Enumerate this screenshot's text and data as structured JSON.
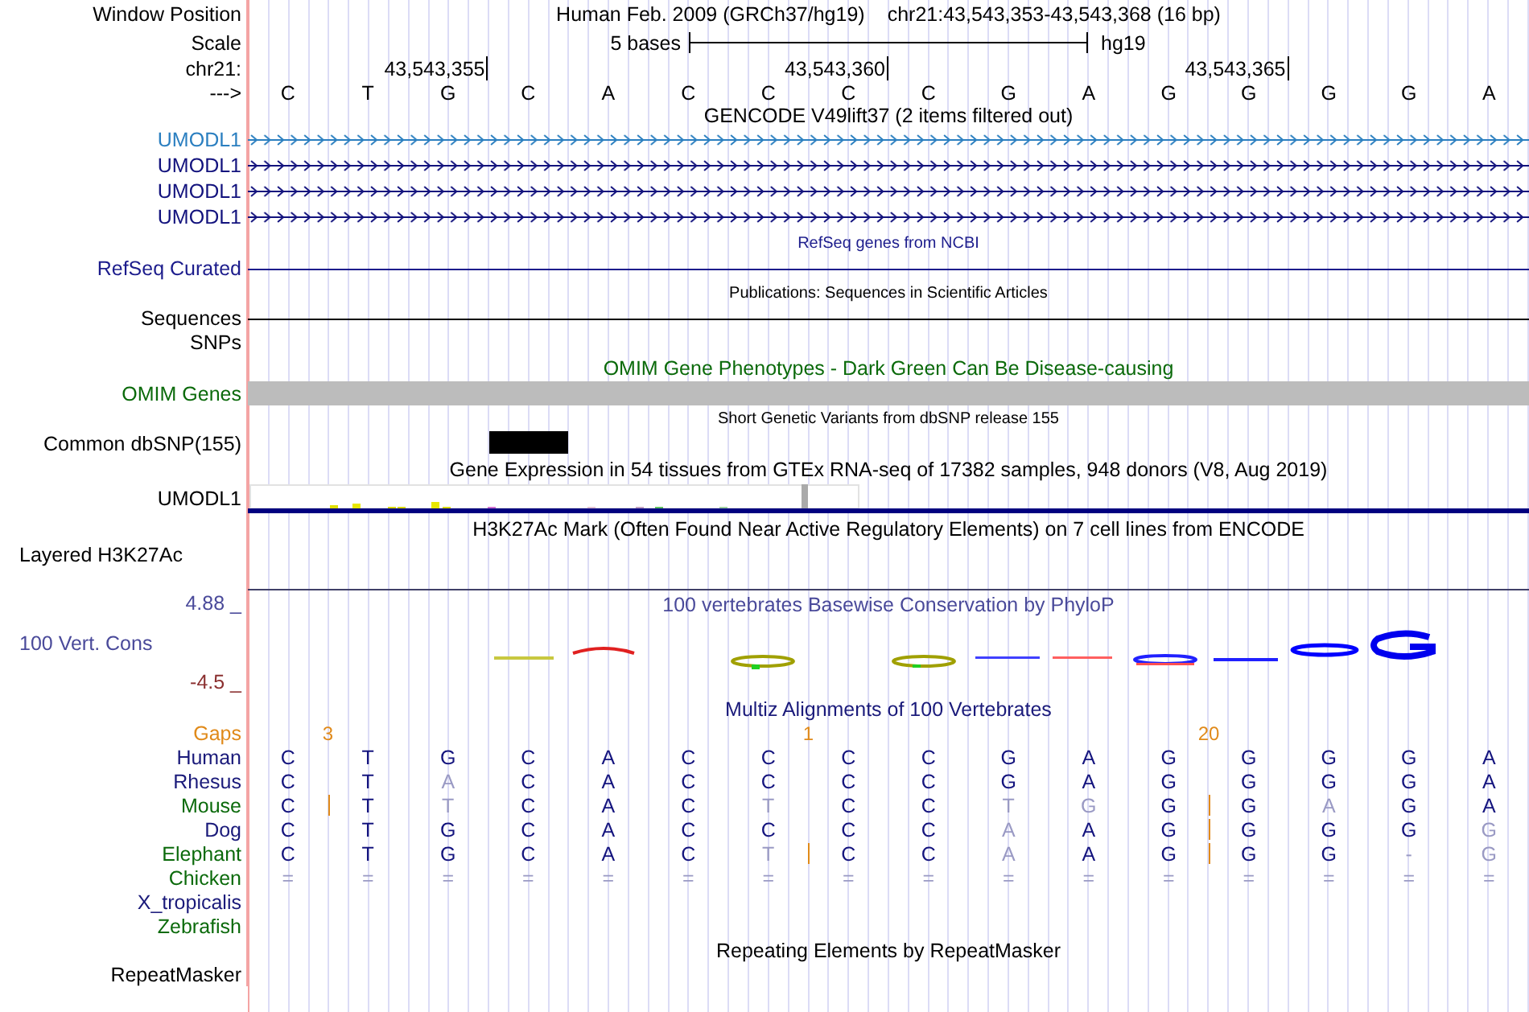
{
  "header": {
    "position_label": "Window Position",
    "assembly": "Human Feb. 2009 (GRCh37/hg19)",
    "position": "chr21:43,543,353-43,543,368 (16 bp)",
    "scale_label": "Scale",
    "scale_text": "5 bases",
    "scale_assembly": "hg19",
    "chrom_label": "chr21:",
    "strand_label": "--->",
    "bases": [
      {
        "base": "C"
      },
      {
        "base": "T"
      },
      {
        "base": "G",
        "tick": "43,543,355"
      },
      {
        "base": "C"
      },
      {
        "base": "A"
      },
      {
        "base": "C"
      },
      {
        "base": "C"
      },
      {
        "base": "C",
        "tick": "43,543,360"
      },
      {
        "base": "C"
      },
      {
        "base": "G"
      },
      {
        "base": "A"
      },
      {
        "base": "G"
      },
      {
        "base": "G",
        "tick": "43,543,365"
      },
      {
        "base": "G"
      },
      {
        "base": "G"
      },
      {
        "base": "A"
      }
    ]
  },
  "tracks": [
    {
      "kind": "gene",
      "title": "GENCODE V49lift37 (2 items filtered out)",
      "color": "#000000",
      "items": [
        {
          "label": "UMODL1",
          "color": "#2b7fc0"
        },
        {
          "label": "UMODL1",
          "color": "#12127d"
        },
        {
          "label": "UMODL1",
          "color": "#12127d"
        },
        {
          "label": "UMODL1",
          "color": "#12127d"
        }
      ]
    },
    {
      "kind": "line",
      "title": "RefSeq genes from NCBI",
      "color": "#1c1c8c",
      "labels": [
        "RefSeq Curated"
      ]
    },
    {
      "kind": "line",
      "title": "Publications: Sequences in Scientific Articles",
      "color": "#000000",
      "labels": [
        "Sequences",
        "SNPs"
      ]
    },
    {
      "kind": "bar",
      "title": "OMIM Gene Phenotypes - Dark Green Can Be Disease-causing",
      "color": "#0b6a0b",
      "labels": [
        "OMIM Genes"
      ]
    },
    {
      "kind": "snp",
      "title": "Short Genetic Variants from dbSNP release 155",
      "color": "#000000",
      "labels": [
        "Common dbSNP(155)"
      ],
      "columns": [
        {
          "variant": false
        },
        {
          "variant": false
        },
        {
          "variant": false
        },
        {
          "variant": true
        },
        {
          "variant": false
        },
        {
          "variant": false
        },
        {
          "variant": false
        },
        {
          "variant": false
        },
        {
          "variant": false
        },
        {
          "variant": false
        },
        {
          "variant": false
        },
        {
          "variant": false
        },
        {
          "variant": false
        },
        {
          "variant": false
        },
        {
          "variant": false
        },
        {
          "variant": false
        }
      ]
    },
    {
      "kind": "expression",
      "title": "Gene Expression in 54 tissues from GTEx RNA-seq of 17382 samples, 948 donors (V8, Aug 2019)",
      "color": "#000000",
      "labels": [
        "UMODL1"
      ]
    },
    {
      "kind": "layered",
      "title": "H3K27Ac Mark (Often Found Near Active Regulatory Elements) on 7 cell lines from ENCODE",
      "color": "#000000",
      "labels": [
        "Layered H3K27Ac"
      ]
    },
    {
      "kind": "conservation",
      "title": "100 vertebrates Basewise Conservation by PhyloP",
      "color": "#4a4a9a",
      "labels": [
        "100 Vert. Cons"
      ],
      "max_label": "4.88 _",
      "min_label": "-4.5 _"
    },
    {
      "kind": "alignment",
      "title": "Multiz Alignments of 100 Vertebrates",
      "color": "#1a1a7a",
      "gap_label": "Gaps",
      "species": [
        {
          "name": "Human",
          "color": "#1a1a7a",
          "bases": [
            {
              "b": "C",
              "faded": false,
              "insert_after": false,
              "gap": "3"
            },
            {
              "b": "T",
              "faded": false,
              "insert_after": false
            },
            {
              "b": "G",
              "faded": false,
              "insert_after": false
            },
            {
              "b": "C",
              "faded": false,
              "insert_after": false
            },
            {
              "b": "A",
              "faded": false,
              "insert_after": false
            },
            {
              "b": "C",
              "faded": false,
              "insert_after": false
            },
            {
              "b": "C",
              "faded": false,
              "insert_after": false,
              "gap": "1"
            },
            {
              "b": "C",
              "faded": false,
              "insert_after": false
            },
            {
              "b": "C",
              "faded": false,
              "insert_after": false
            },
            {
              "b": "G",
              "faded": false,
              "insert_after": false
            },
            {
              "b": "A",
              "faded": false,
              "insert_after": false
            },
            {
              "b": "G",
              "faded": false,
              "insert_after": false,
              "gap": "20"
            },
            {
              "b": "G",
              "faded": false,
              "insert_after": false
            },
            {
              "b": "G",
              "faded": false,
              "insert_after": false
            },
            {
              "b": "G",
              "faded": false,
              "insert_after": false
            },
            {
              "b": "A",
              "faded": false,
              "insert_after": false
            }
          ]
        },
        {
          "name": "Rhesus",
          "color": "#1a1a7a",
          "bases": [
            {
              "b": "C",
              "faded": false,
              "insert_after": false
            },
            {
              "b": "T",
              "faded": false,
              "insert_after": false
            },
            {
              "b": "A",
              "faded": true,
              "insert_after": false
            },
            {
              "b": "C",
              "faded": false,
              "insert_after": false
            },
            {
              "b": "A",
              "faded": false,
              "insert_after": false
            },
            {
              "b": "C",
              "faded": false,
              "insert_after": false
            },
            {
              "b": "C",
              "faded": false,
              "insert_after": false
            },
            {
              "b": "C",
              "faded": false,
              "insert_after": false
            },
            {
              "b": "C",
              "faded": false,
              "insert_after": false
            },
            {
              "b": "G",
              "faded": false,
              "insert_after": false
            },
            {
              "b": "A",
              "faded": false,
              "insert_after": false
            },
            {
              "b": "G",
              "faded": false,
              "insert_after": false
            },
            {
              "b": "G",
              "faded": false,
              "insert_after": false
            },
            {
              "b": "G",
              "faded": false,
              "insert_after": false
            },
            {
              "b": "G",
              "faded": false,
              "insert_after": false
            },
            {
              "b": "A",
              "faded": false,
              "insert_after": false
            }
          ]
        },
        {
          "name": "Mouse",
          "color": "#0b6a0b",
          "bases": [
            {
              "b": "C",
              "faded": false,
              "insert_after": true
            },
            {
              "b": "T",
              "faded": false,
              "insert_after": false
            },
            {
              "b": "T",
              "faded": true,
              "insert_after": false
            },
            {
              "b": "C",
              "faded": false,
              "insert_after": false
            },
            {
              "b": "A",
              "faded": false,
              "insert_after": false
            },
            {
              "b": "C",
              "faded": false,
              "insert_after": false
            },
            {
              "b": "T",
              "faded": true,
              "insert_after": false
            },
            {
              "b": "C",
              "faded": false,
              "insert_after": false
            },
            {
              "b": "C",
              "faded": false,
              "insert_after": false
            },
            {
              "b": "T",
              "faded": true,
              "insert_after": false
            },
            {
              "b": "G",
              "faded": true,
              "insert_after": false
            },
            {
              "b": "G",
              "faded": false,
              "insert_after": true
            },
            {
              "b": "G",
              "faded": false,
              "insert_after": false
            },
            {
              "b": "A",
              "faded": true,
              "insert_after": false
            },
            {
              "b": "G",
              "faded": false,
              "insert_after": false
            },
            {
              "b": "A",
              "faded": false,
              "insert_after": false
            }
          ]
        },
        {
          "name": "Dog",
          "color": "#1a1a7a",
          "bases": [
            {
              "b": "C",
              "faded": false,
              "insert_after": false
            },
            {
              "b": "T",
              "faded": false,
              "insert_after": false
            },
            {
              "b": "G",
              "faded": false,
              "insert_after": false
            },
            {
              "b": "C",
              "faded": false,
              "insert_after": false
            },
            {
              "b": "A",
              "faded": false,
              "insert_after": false
            },
            {
              "b": "C",
              "faded": false,
              "insert_after": false
            },
            {
              "b": "C",
              "faded": false,
              "insert_after": false
            },
            {
              "b": "C",
              "faded": false,
              "insert_after": false
            },
            {
              "b": "C",
              "faded": false,
              "insert_after": false
            },
            {
              "b": "A",
              "faded": true,
              "insert_after": false
            },
            {
              "b": "A",
              "faded": false,
              "insert_after": false
            },
            {
              "b": "G",
              "faded": false,
              "insert_after": true
            },
            {
              "b": "G",
              "faded": false,
              "insert_after": false
            },
            {
              "b": "G",
              "faded": false,
              "insert_after": false
            },
            {
              "b": "G",
              "faded": false,
              "insert_after": false
            },
            {
              "b": "G",
              "faded": true,
              "insert_after": false
            }
          ]
        },
        {
          "name": "Elephant",
          "color": "#0b6a0b",
          "bases": [
            {
              "b": "C",
              "faded": false,
              "insert_after": false
            },
            {
              "b": "T",
              "faded": false,
              "insert_after": false
            },
            {
              "b": "G",
              "faded": false,
              "insert_after": false
            },
            {
              "b": "C",
              "faded": false,
              "insert_after": false
            },
            {
              "b": "A",
              "faded": false,
              "insert_after": false
            },
            {
              "b": "C",
              "faded": false,
              "insert_after": false
            },
            {
              "b": "T",
              "faded": true,
              "insert_after": true
            },
            {
              "b": "C",
              "faded": false,
              "insert_after": false
            },
            {
              "b": "C",
              "faded": false,
              "insert_after": false
            },
            {
              "b": "A",
              "faded": true,
              "insert_after": false
            },
            {
              "b": "A",
              "faded": false,
              "insert_after": false
            },
            {
              "b": "G",
              "faded": false,
              "insert_after": true
            },
            {
              "b": "G",
              "faded": false,
              "insert_after": false
            },
            {
              "b": "G",
              "faded": false,
              "insert_after": false
            },
            {
              "b": "-",
              "faded": true,
              "insert_after": false
            },
            {
              "b": "G",
              "faded": true,
              "insert_after": false
            }
          ]
        },
        {
          "name": "Chicken",
          "color": "#0b6a0b",
          "bases": [
            {
              "b": "=",
              "faded": true,
              "insert_after": false
            },
            {
              "b": "=",
              "faded": true,
              "insert_after": false
            },
            {
              "b": "=",
              "faded": true,
              "insert_after": false
            },
            {
              "b": "=",
              "faded": true,
              "insert_after": false
            },
            {
              "b": "=",
              "faded": true,
              "insert_after": false
            },
            {
              "b": "=",
              "faded": true,
              "insert_after": false
            },
            {
              "b": "=",
              "faded": true,
              "insert_after": false
            },
            {
              "b": "=",
              "faded": true,
              "insert_after": false
            },
            {
              "b": "=",
              "faded": true,
              "insert_after": false
            },
            {
              "b": "=",
              "faded": true,
              "insert_after": false
            },
            {
              "b": "=",
              "faded": true,
              "insert_after": false
            },
            {
              "b": "=",
              "faded": true,
              "insert_after": false
            },
            {
              "b": "=",
              "faded": true,
              "insert_after": false
            },
            {
              "b": "=",
              "faded": true,
              "insert_after": false
            },
            {
              "b": "=",
              "faded": true,
              "insert_after": false
            },
            {
              "b": "=",
              "faded": true,
              "insert_after": false
            }
          ]
        },
        {
          "name": "X_tropicalis",
          "color": "#1a1a7a"
        },
        {
          "name": "Zebrafish",
          "color": "#0b6a0b"
        }
      ]
    },
    {
      "kind": "empty",
      "title": "Repeating Elements by RepeatMasker",
      "color": "#000000",
      "labels": [
        "RepeatMasker"
      ]
    }
  ]
}
